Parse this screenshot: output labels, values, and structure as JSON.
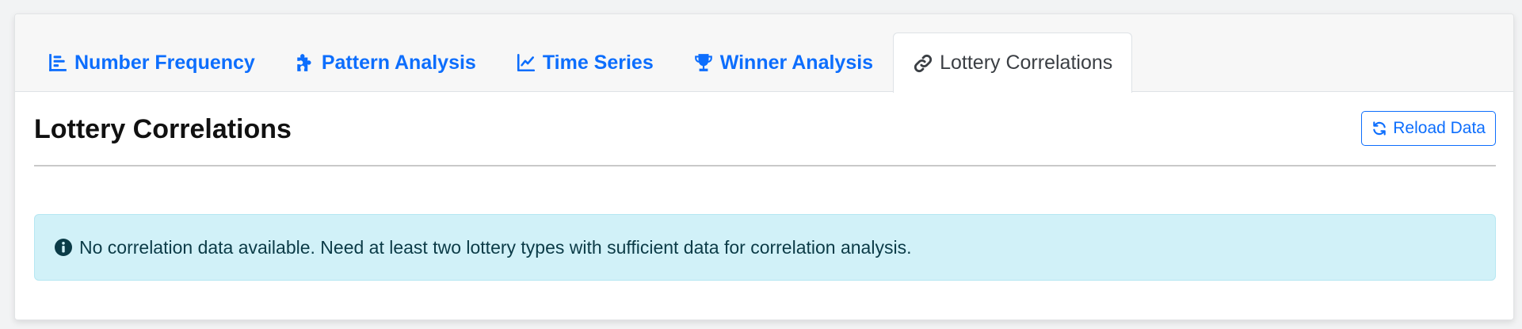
{
  "tabs": [
    {
      "label": "Number Frequency",
      "icon": "chart-bar-icon",
      "active": false
    },
    {
      "label": "Pattern Analysis",
      "icon": "puzzle-icon",
      "active": false
    },
    {
      "label": "Time Series",
      "icon": "chart-line-icon",
      "active": false
    },
    {
      "label": "Winner Analysis",
      "icon": "trophy-icon",
      "active": false
    },
    {
      "label": "Lottery Correlations",
      "icon": "link-icon",
      "active": true
    }
  ],
  "page_title": "Lottery Correlations",
  "reload_button": {
    "label": "Reload Data",
    "icon": "refresh-icon"
  },
  "alert": {
    "icon": "info-circle-icon",
    "message": "No correlation data available. Need at least two lottery types with sufficient data for correlation analysis."
  },
  "colors": {
    "accent": "#0d6efd",
    "alert_bg": "#d1f1f8",
    "alert_text": "#0b3b47"
  }
}
